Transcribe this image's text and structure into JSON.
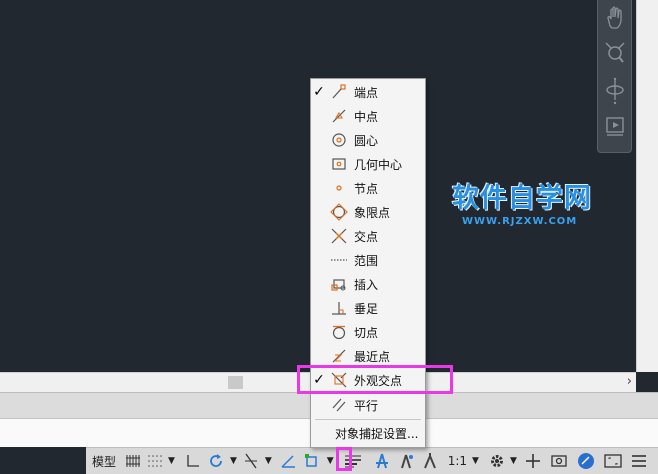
{
  "status_bar": {
    "model_label": "模型",
    "scale_label": "1:1"
  },
  "osnap_menu": {
    "items": [
      {
        "label": "端点",
        "checked": true,
        "icon": "endpoint-icon"
      },
      {
        "label": "中点",
        "checked": false,
        "icon": "midpoint-icon"
      },
      {
        "label": "圆心",
        "checked": false,
        "icon": "center-icon"
      },
      {
        "label": "几何中心",
        "checked": false,
        "icon": "geometric-center-icon"
      },
      {
        "label": "节点",
        "checked": false,
        "icon": "node-icon"
      },
      {
        "label": "象限点",
        "checked": false,
        "icon": "quadrant-icon"
      },
      {
        "label": "交点",
        "checked": false,
        "icon": "intersection-icon"
      },
      {
        "label": "范围",
        "checked": false,
        "icon": "extension-icon"
      },
      {
        "label": "插入",
        "checked": false,
        "icon": "insertion-icon"
      },
      {
        "label": "垂足",
        "checked": false,
        "icon": "perpendicular-icon"
      },
      {
        "label": "切点",
        "checked": false,
        "icon": "tangent-icon"
      },
      {
        "label": "最近点",
        "checked": false,
        "icon": "nearest-icon"
      },
      {
        "label": "外观交点",
        "checked": true,
        "icon": "apparent-intersection-icon"
      },
      {
        "label": "平行",
        "checked": false,
        "icon": "parallel-icon"
      }
    ],
    "settings_label": "对象捕捉设置...",
    "check_glyph": "✓"
  },
  "watermark": {
    "title": "软件自学网",
    "url": "WWW.RJZXW.COM"
  },
  "colors": {
    "canvas": "#212830",
    "accent_orange": "#e07020",
    "highlight": "#e838e8",
    "watermark_blue": "#2b8fe0"
  }
}
